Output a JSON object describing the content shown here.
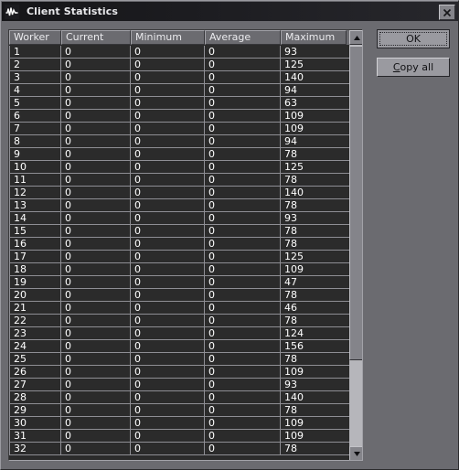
{
  "window": {
    "title": "Client Statistics",
    "icon": "waveform-icon",
    "close_label": "×",
    "bg_color": "#6b6b70",
    "titlebar_color": "#1a1a1e"
  },
  "buttons": {
    "ok_label": "OK",
    "copy_all_label": "Copy all",
    "copy_all_accel": "C"
  },
  "scrollbar": {
    "up_icon": "triangle-up-icon",
    "down_icon": "triangle-down-icon",
    "thumb": "scrollbar-thumb"
  },
  "table": {
    "columns": [
      "Worker",
      "Current",
      "Minimum",
      "Average",
      "Maximum"
    ],
    "rows": [
      [
        "1",
        "0",
        "0",
        "0",
        "93"
      ],
      [
        "2",
        "0",
        "0",
        "0",
        "125"
      ],
      [
        "3",
        "0",
        "0",
        "0",
        "140"
      ],
      [
        "4",
        "0",
        "0",
        "0",
        "94"
      ],
      [
        "5",
        "0",
        "0",
        "0",
        "63"
      ],
      [
        "6",
        "0",
        "0",
        "0",
        "109"
      ],
      [
        "7",
        "0",
        "0",
        "0",
        "109"
      ],
      [
        "8",
        "0",
        "0",
        "0",
        "94"
      ],
      [
        "9",
        "0",
        "0",
        "0",
        "78"
      ],
      [
        "10",
        "0",
        "0",
        "0",
        "125"
      ],
      [
        "11",
        "0",
        "0",
        "0",
        "78"
      ],
      [
        "12",
        "0",
        "0",
        "0",
        "140"
      ],
      [
        "13",
        "0",
        "0",
        "0",
        "78"
      ],
      [
        "14",
        "0",
        "0",
        "0",
        "93"
      ],
      [
        "15",
        "0",
        "0",
        "0",
        "78"
      ],
      [
        "16",
        "0",
        "0",
        "0",
        "78"
      ],
      [
        "17",
        "0",
        "0",
        "0",
        "125"
      ],
      [
        "18",
        "0",
        "0",
        "0",
        "109"
      ],
      [
        "19",
        "0",
        "0",
        "0",
        "47"
      ],
      [
        "20",
        "0",
        "0",
        "0",
        "78"
      ],
      [
        "21",
        "0",
        "0",
        "0",
        "46"
      ],
      [
        "22",
        "0",
        "0",
        "0",
        "78"
      ],
      [
        "23",
        "0",
        "0",
        "0",
        "124"
      ],
      [
        "24",
        "0",
        "0",
        "0",
        "156"
      ],
      [
        "25",
        "0",
        "0",
        "0",
        "78"
      ],
      [
        "26",
        "0",
        "0",
        "0",
        "109"
      ],
      [
        "27",
        "0",
        "0",
        "0",
        "93"
      ],
      [
        "28",
        "0",
        "0",
        "0",
        "140"
      ],
      [
        "29",
        "0",
        "0",
        "0",
        "78"
      ],
      [
        "30",
        "0",
        "0",
        "0",
        "109"
      ],
      [
        "31",
        "0",
        "0",
        "0",
        "109"
      ],
      [
        "32",
        "0",
        "0",
        "0",
        "78"
      ]
    ]
  }
}
